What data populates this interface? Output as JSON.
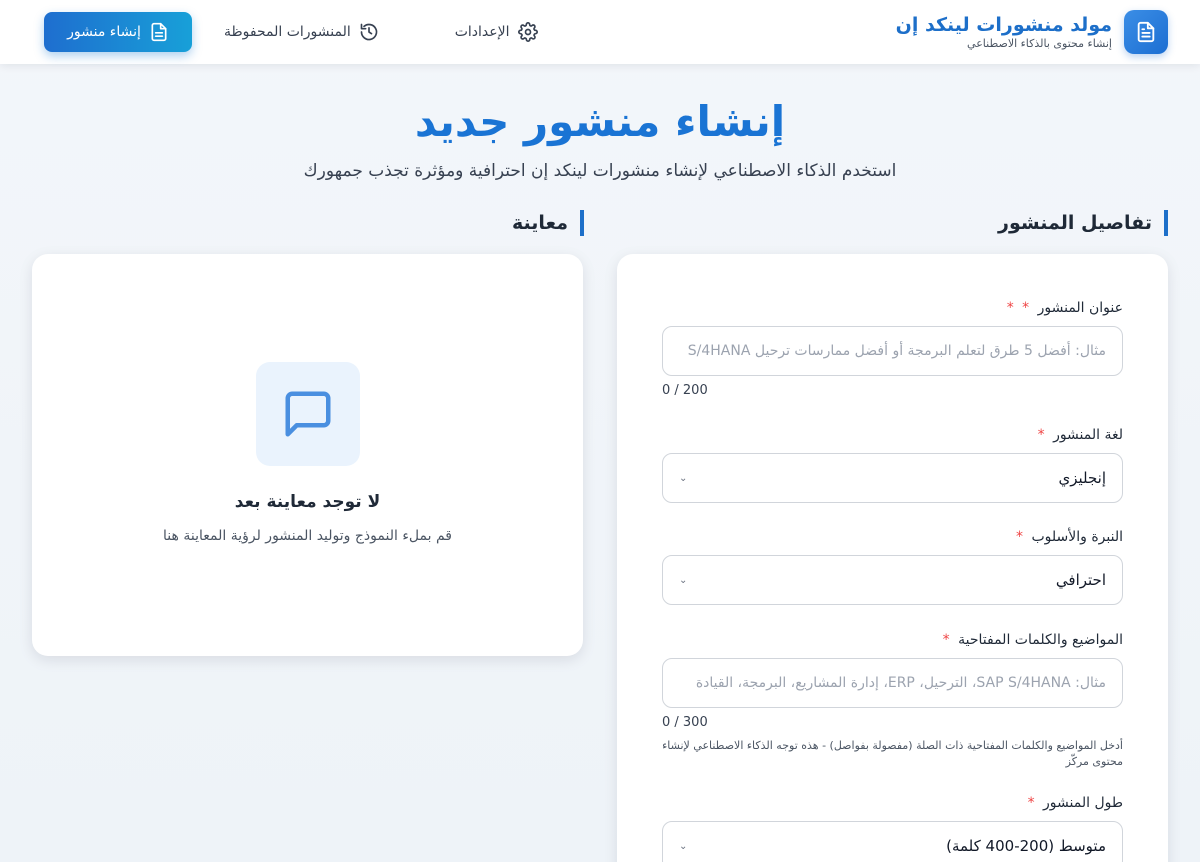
{
  "header": {
    "brand_title": "مولد منشورات لينكد إن",
    "brand_subtitle": "إنشاء محتوى بالذكاء الاصطناعي",
    "nav": {
      "create": "إنشاء منشور",
      "saved": "المنشورات المحفوظة",
      "settings": "الإعدادات"
    }
  },
  "hero": {
    "title": "إنشاء منشور جديد",
    "subtitle": "استخدم الذكاء الاصطناعي لإنشاء منشورات لينكد إن احترافية ومؤثرة تجذب جمهورك"
  },
  "form": {
    "heading": "تفاصيل المنشور",
    "title_field": {
      "label": "عنوان المنشور",
      "required_mark": "*",
      "placeholder": "مثال: أفضل 5 طرق لتعلم البرمجة أو أفضل ممارسات ترحيل S/4HANA",
      "counter": "0 / 200"
    },
    "language_field": {
      "label": "لغة المنشور",
      "required_mark": "*",
      "value": "إنجليزي"
    },
    "tone_field": {
      "label": "النبرة والأسلوب",
      "required_mark": "*",
      "value": "احترافي"
    },
    "topics_field": {
      "label": "المواضيع والكلمات المفتاحية",
      "required_mark": "*",
      "placeholder": "مثال: SAP S/4HANA، الترحيل، ERP، إدارة المشاريع، البرمجة، القيادة",
      "counter": "0 / 300",
      "hint": "أدخل المواضيع والكلمات المفتاحية ذات الصلة (مفصولة بفواصل) - هذه توجه الذكاء الاصطناعي لإنشاء محتوى مركّز"
    },
    "length_field": {
      "label": "طول المنشور",
      "required_mark": "*",
      "value": "متوسط (200-400 كلمة)"
    }
  },
  "preview": {
    "heading": "معاينة",
    "empty_title": "لا توجد معاينة بعد",
    "empty_subtitle": "قم بملء النموذج وتوليد المنشور لرؤية المعاينة هنا"
  },
  "colors": {
    "accent": "#1d6fc9",
    "required": "#ef4444"
  }
}
